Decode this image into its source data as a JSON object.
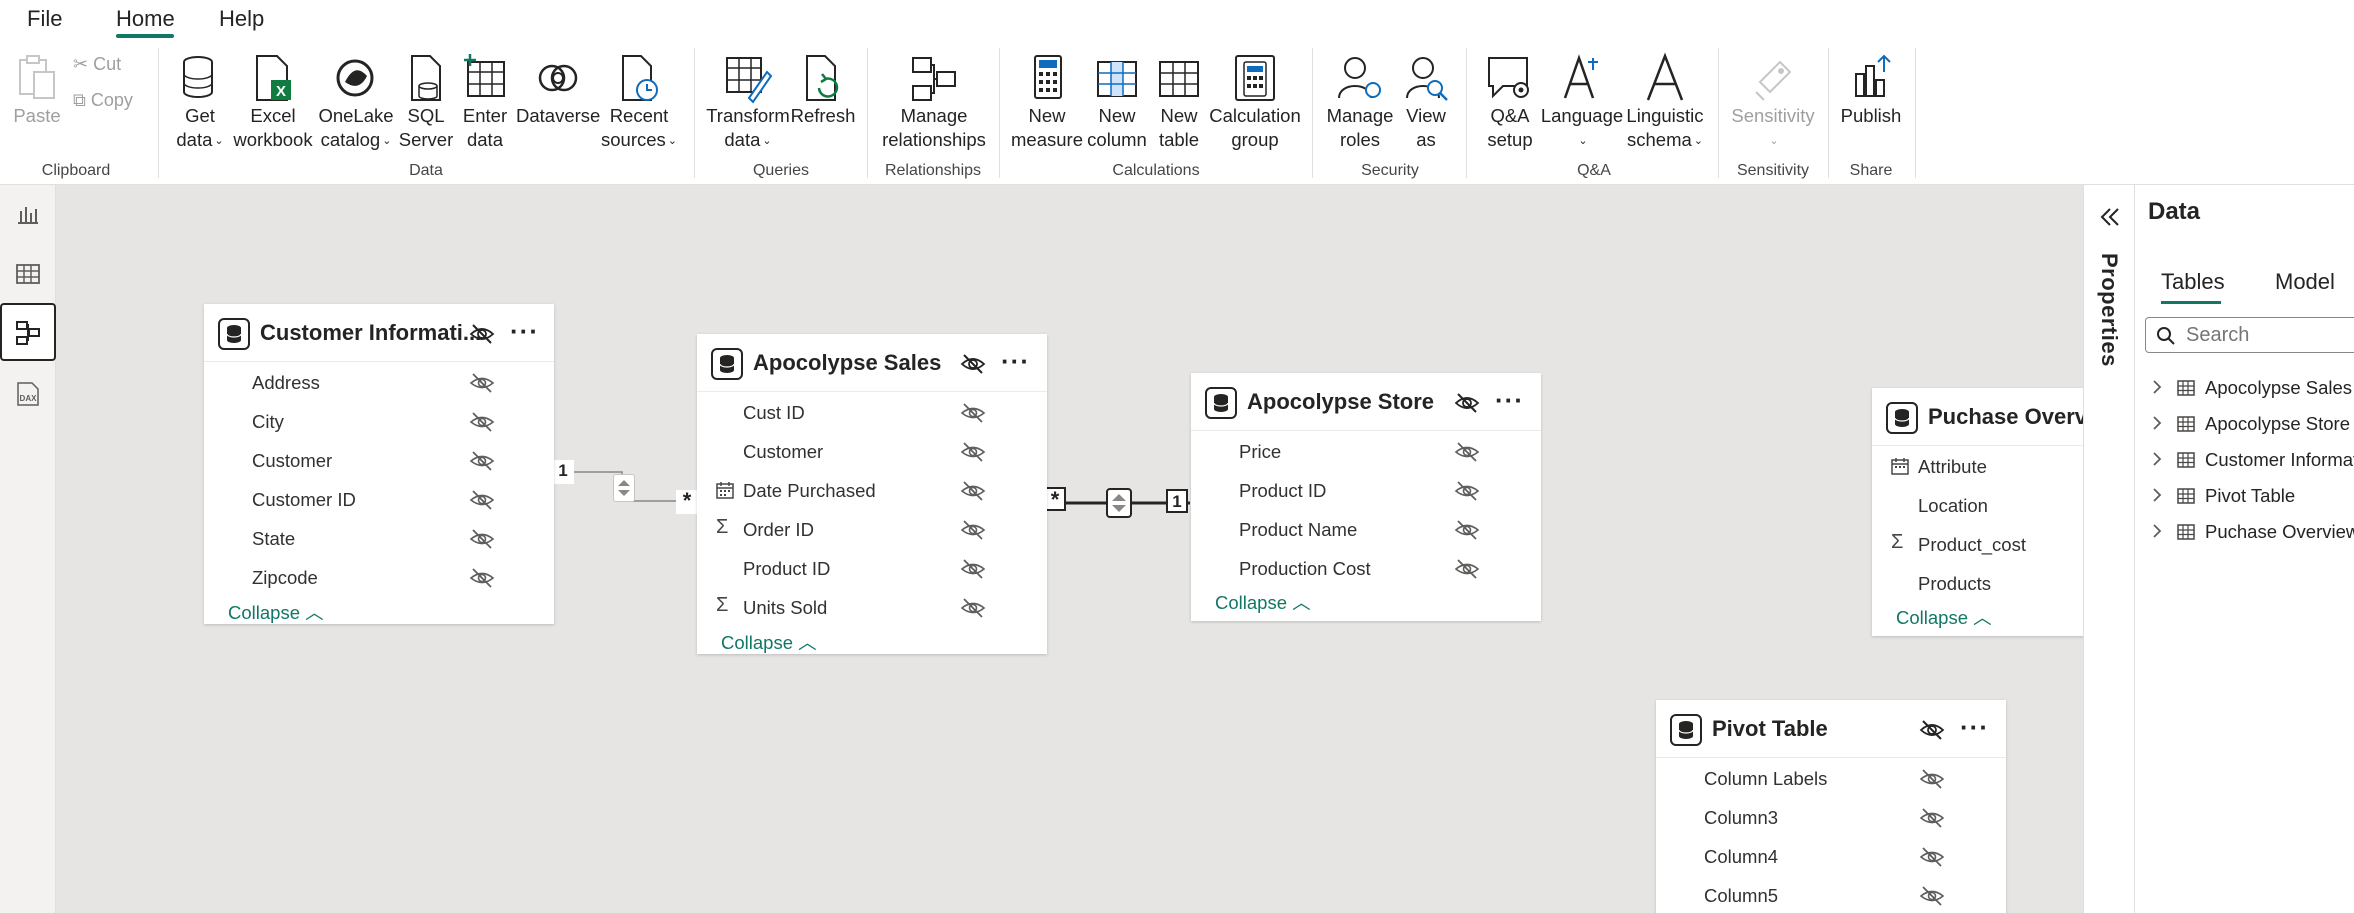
{
  "menu": {
    "file": "File",
    "home": "Home",
    "help": "Help"
  },
  "ribbon": {
    "paste": "Paste",
    "cut": "Cut",
    "copy": "Copy",
    "get_data": [
      "Get",
      "data"
    ],
    "excel": [
      "Excel",
      "workbook"
    ],
    "onelake": [
      "OneLake",
      "catalog"
    ],
    "sql": [
      "SQL",
      "Server"
    ],
    "enter": [
      "Enter",
      "data"
    ],
    "dataverse": "Dataverse",
    "recent": [
      "Recent",
      "sources"
    ],
    "transform": [
      "Transform",
      "data"
    ],
    "refresh": "Refresh",
    "manage_rel": [
      "Manage",
      "relationships"
    ],
    "new_measure": [
      "New",
      "measure"
    ],
    "new_column": [
      "New",
      "column"
    ],
    "new_table": [
      "New",
      "table"
    ],
    "calc_group": [
      "Calculation",
      "group"
    ],
    "manage_roles": [
      "Manage",
      "roles"
    ],
    "view_as": [
      "View",
      "as"
    ],
    "qa_setup": [
      "Q&A",
      "setup"
    ],
    "language": "Language",
    "ling_schema": [
      "Linguistic",
      "schema"
    ],
    "sensitivity": "Sensitivity",
    "publish": "Publish",
    "groups": {
      "clipboard": "Clipboard",
      "data": "Data",
      "queries": "Queries",
      "relationships": "Relationships",
      "calculations": "Calculations",
      "security": "Security",
      "qa": "Q&A",
      "sensitivity": "Sensitivity",
      "share": "Share"
    }
  },
  "tables": {
    "customer": {
      "title": "Customer Informati...",
      "fields": [
        "Address",
        "City",
        "Customer",
        "Customer ID",
        "State",
        "Zipcode"
      ],
      "collapse": "Collapse"
    },
    "sales": {
      "title": "Apocolypse Sales",
      "fields": [
        "Cust ID",
        "Customer",
        "Date Purchased",
        "Order ID",
        "Product ID",
        "Units Sold"
      ],
      "collapse": "Collapse"
    },
    "store": {
      "title": "Apocolypse Store",
      "fields": [
        "Price",
        "Product ID",
        "Product Name",
        "Production Cost"
      ],
      "collapse": "Collapse"
    },
    "puchase": {
      "title": "Puchase Overvie",
      "fields": [
        "Attribute",
        "Location",
        "Product_cost",
        "Products"
      ],
      "collapse": "Collapse"
    },
    "pivot": {
      "title": "Pivot Table",
      "fields": [
        "Column Labels",
        "Column3",
        "Column4",
        "Column5"
      ]
    }
  },
  "relationships": {
    "rel1": {
      "one": "1",
      "many": "*"
    },
    "rel2": {
      "one": "1",
      "many": "*"
    }
  },
  "properties": {
    "label": "Properties"
  },
  "datapane": {
    "title": "Data",
    "tab_tables": "Tables",
    "tab_model": "Model",
    "search_placeholder": "Search",
    "items": [
      "Apocolypse Sales",
      "Apocolypse Store",
      "Customer Informati",
      "Pivot Table",
      "Puchase Overview"
    ]
  },
  "colors": {
    "accent": "#117865",
    "canvas": "#e6e5e4"
  }
}
